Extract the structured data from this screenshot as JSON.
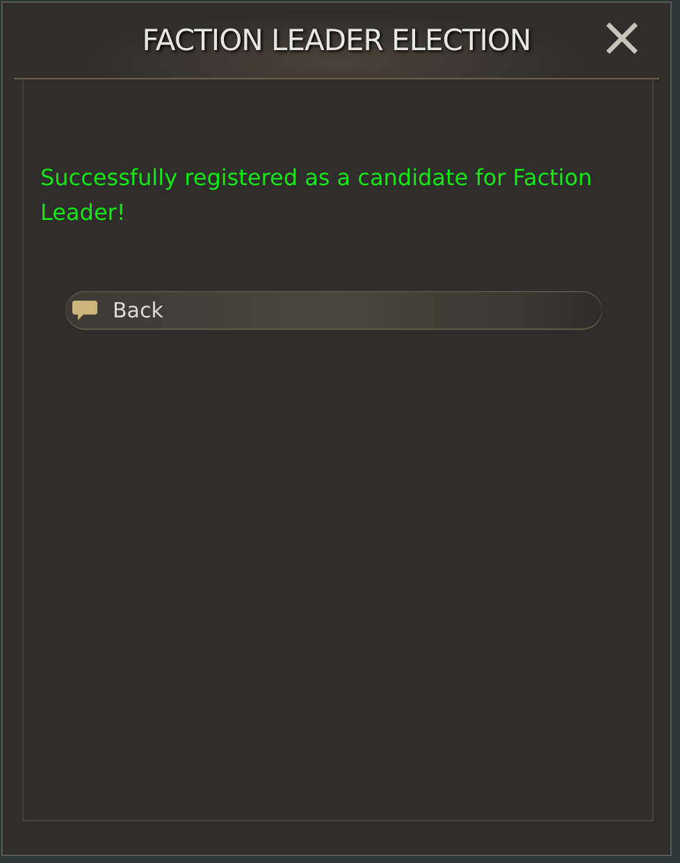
{
  "window": {
    "title": "FACTION LEADER ELECTION",
    "close": "×"
  },
  "message": "Successfully registered as a candidate for Faction Leader!",
  "options": [
    {
      "label": "Back"
    }
  ]
}
